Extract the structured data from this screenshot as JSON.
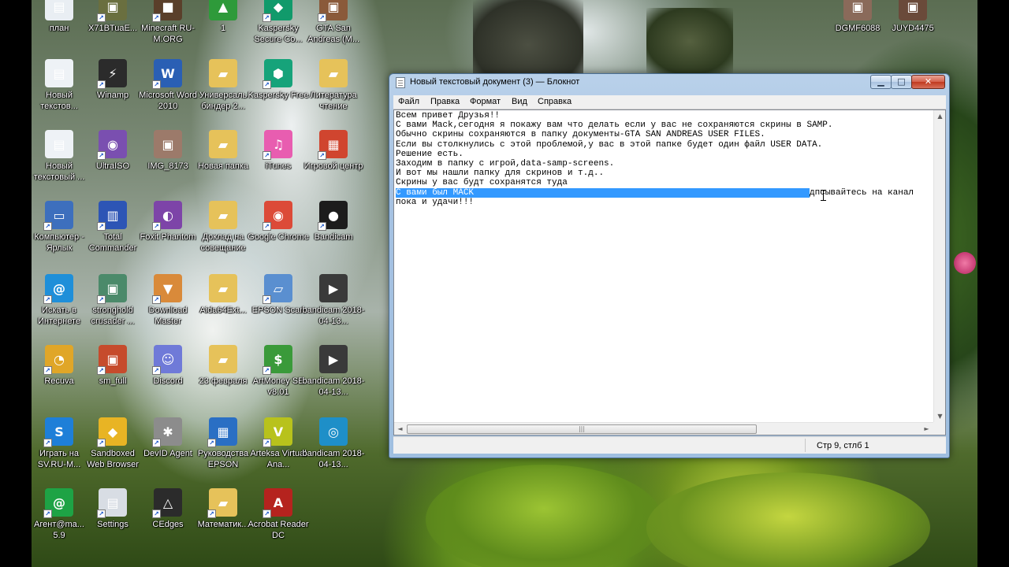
{
  "desktop": {
    "icons": [
      {
        "label": "план",
        "glyph": "▤",
        "color": "#e9eef3",
        "shortcut": false
      },
      {
        "label": "X71BTuaE...",
        "glyph": "▣",
        "color": "#6a6f3f",
        "shortcut": true
      },
      {
        "label": "Minecraft RU-M.ORG",
        "glyph": "■",
        "color": "#5a3f2a",
        "shortcut": true
      },
      {
        "label": "1",
        "glyph": "▲",
        "color": "#2e9a3a",
        "shortcut": false
      },
      {
        "label": "Kaspersky Secure Co...",
        "glyph": "◆",
        "color": "#119a6b",
        "shortcut": true
      },
      {
        "label": "GTA San Andreas (M...",
        "glyph": "▣",
        "color": "#8a5a3a",
        "shortcut": true
      },
      {
        "label": "Новый текстов...",
        "glyph": "▤",
        "color": "#eef2f6",
        "shortcut": false
      },
      {
        "label": "Winamp",
        "glyph": "⚡",
        "color": "#2b2b2b",
        "shortcut": true
      },
      {
        "label": "Microsoft Word 2010",
        "glyph": "W",
        "color": "#2a5fb4",
        "shortcut": true
      },
      {
        "label": "Универсаль биндер 2...",
        "glyph": "▰",
        "color": "#e6c25a",
        "shortcut": false
      },
      {
        "label": "Kaspersky Free",
        "glyph": "⬢",
        "color": "#16a37a",
        "shortcut": true
      },
      {
        "label": "Литература чтение",
        "glyph": "▰",
        "color": "#e6c25a",
        "shortcut": false
      },
      {
        "label": "Новый текстовый ...",
        "glyph": "▤",
        "color": "#eef2f6",
        "shortcut": false
      },
      {
        "label": "UltraISO",
        "glyph": "◉",
        "color": "#7a4fb0",
        "shortcut": true
      },
      {
        "label": "IMG_8173",
        "glyph": "▣",
        "color": "#9c7a6a",
        "shortcut": false
      },
      {
        "label": "Новая папка",
        "glyph": "▰",
        "color": "#e6c25a",
        "shortcut": false
      },
      {
        "label": "iTunes",
        "glyph": "♫",
        "color": "#e85db0",
        "shortcut": true
      },
      {
        "label": "Игровой центр",
        "glyph": "▦",
        "color": "#d0452f",
        "shortcut": true
      },
      {
        "label": "Компьютер - Ярлык",
        "glyph": "▭",
        "color": "#3d6fbd",
        "shortcut": true
      },
      {
        "label": "Total Commander",
        "glyph": "▥",
        "color": "#2d55b5",
        "shortcut": true
      },
      {
        "label": "Foxit Phantom",
        "glyph": "◐",
        "color": "#7d44a8",
        "shortcut": true
      },
      {
        "label": "Доклад на совещание",
        "glyph": "▰",
        "color": "#e6c25a",
        "shortcut": false
      },
      {
        "label": "Google Chrome",
        "glyph": "◉",
        "color": "#dc4a38",
        "shortcut": true
      },
      {
        "label": "Bandicam",
        "glyph": "●",
        "color": "#1c1c1c",
        "shortcut": true
      },
      {
        "label": "Искать в Интернете",
        "glyph": "@",
        "color": "#1f8fd9",
        "shortcut": true
      },
      {
        "label": "stronghold crusader ...",
        "glyph": "▣",
        "color": "#4b8a6a",
        "shortcut": true
      },
      {
        "label": "Download Master",
        "glyph": "▼",
        "color": "#d98a3a",
        "shortcut": true
      },
      {
        "label": "Aida64Ext...",
        "glyph": "▰",
        "color": "#e6c25a",
        "shortcut": false
      },
      {
        "label": "EPSON Scan",
        "glyph": "▱",
        "color": "#5a8fd0",
        "shortcut": true
      },
      {
        "label": "bandicam 2018-04-13...",
        "glyph": "▶",
        "color": "#3a3a3a",
        "shortcut": false
      },
      {
        "label": "Recuva",
        "glyph": "◔",
        "color": "#e0a628",
        "shortcut": true
      },
      {
        "label": "sm_full",
        "glyph": "▣",
        "color": "#c64b2c",
        "shortcut": true
      },
      {
        "label": "Discord",
        "glyph": "☺",
        "color": "#6f7ad8",
        "shortcut": true
      },
      {
        "label": "23 февраля",
        "glyph": "▰",
        "color": "#e6c25a",
        "shortcut": false
      },
      {
        "label": "ArtMoney SE v8.01",
        "glyph": "$",
        "color": "#3a9a3a",
        "shortcut": true
      },
      {
        "label": "bandicam 2018-04-13...",
        "glyph": "▶",
        "color": "#3a3a3a",
        "shortcut": false
      },
      {
        "label": "Играть на SV.RU-M...",
        "glyph": "S",
        "color": "#1e7fd8",
        "shortcut": true
      },
      {
        "label": "Sandboxed Web Browser",
        "glyph": "◆",
        "color": "#e8b424",
        "shortcut": true
      },
      {
        "label": "DevID Agent",
        "glyph": "✱",
        "color": "#8c8c8c",
        "shortcut": true
      },
      {
        "label": "Руководства EPSON",
        "glyph": "▦",
        "color": "#2a6fc4",
        "shortcut": true
      },
      {
        "label": "Arteksa Virtual Ana...",
        "glyph": "V",
        "color": "#b8c21c",
        "shortcut": true
      },
      {
        "label": "bandicam 2018-04-13...",
        "glyph": "◎",
        "color": "#1e8fc8",
        "shortcut": false
      },
      {
        "label": "Агент@ma... 5.9",
        "glyph": "@",
        "color": "#1ea345",
        "shortcut": true
      },
      {
        "label": "Settings",
        "glyph": "▤",
        "color": "#d8dde4",
        "shortcut": true
      },
      {
        "label": "CEdges",
        "glyph": "△",
        "color": "#2b2b2b",
        "shortcut": true
      },
      {
        "label": "Математик...",
        "glyph": "▰",
        "color": "#e6c25a",
        "shortcut": true
      },
      {
        "label": "Acrobat Reader DC",
        "glyph": "A",
        "color": "#b5231e",
        "shortcut": true
      },
      {
        "label": "DGMF6088",
        "glyph": "▣",
        "color": "#8a6a5a",
        "shortcut": false
      },
      {
        "label": "JUYD4475",
        "glyph": "▣",
        "color": "#6a4a3a",
        "shortcut": false
      }
    ]
  },
  "notepad": {
    "title": "Новый текстовый документ (3) — Блокнот",
    "window_buttons": {
      "minimize": "▁",
      "maximize": "□",
      "close": "✕"
    },
    "menu": [
      "Файл",
      "Правка",
      "Формат",
      "Вид",
      "Справка"
    ],
    "lines": [
      "Всем привет Друзья!!",
      "С вами Mack,сегодня я покажу вам что делать если у вас не сохраняются скрины в SAMP.",
      "Обычно скрины сохраняются в папку документы-GTA SAN ANDREAS USER FILES.",
      "Если вы столкнулись с этой проблемой,у вас в этой папке будет один файл USER DATA.",
      "Решение есть.",
      "Заходим в папку с игрой,data-samp-screens.",
      "И вот мы нашли папку для скринов и т.д..",
      "Скрины у вас будт сохранятся туда"
    ],
    "selected_line": {
      "selected_text": "С вами был MACK",
      "rest_text": "дпсывайтесь на канал"
    },
    "last_line": "пока и удачи!!!",
    "scroll": {
      "up": "▲",
      "down": "▼",
      "left": "◄",
      "right": "►",
      "thumb_grip": "|||"
    },
    "status": "Стр 9, стлб 1"
  }
}
